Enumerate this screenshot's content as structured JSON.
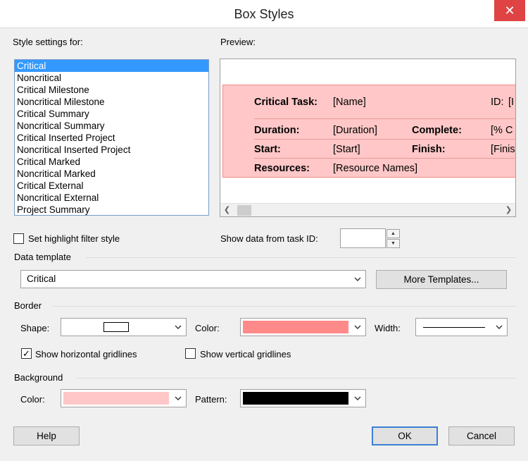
{
  "window": {
    "title": "Box Styles",
    "close_glyph": "✕"
  },
  "style_settings": {
    "label": "Style settings for:",
    "items": [
      "Critical",
      "Noncritical",
      "Critical Milestone",
      "Noncritical Milestone",
      "Critical Summary",
      "Noncritical Summary",
      "Critical Inserted Project",
      "Noncritical Inserted Project",
      "Critical Marked",
      "Noncritical Marked",
      "Critical External",
      "Noncritical External",
      "Project Summary"
    ],
    "selected": "Critical"
  },
  "preview": {
    "label": "Preview:",
    "rows": {
      "critical_task_label": "Critical Task:",
      "name_value": "[Name]",
      "id_label": "ID:",
      "id_value": "[I",
      "duration_label": "Duration:",
      "duration_value": "[Duration]",
      "complete_label": "Complete:",
      "complete_value": "[% C",
      "start_label": "Start:",
      "start_value": "[Start]",
      "finish_label": "Finish:",
      "finish_value": "[Finis",
      "resources_label": "Resources:",
      "resources_value": "[Resource Names]"
    },
    "box_fill_color": "#ffc7c7",
    "box_border_color": "#f08a8a"
  },
  "highlight_filter": {
    "label": "Set highlight filter style",
    "checked": false
  },
  "show_data": {
    "label": "Show data from task ID:",
    "value": ""
  },
  "data_template": {
    "header": "Data template",
    "selected": "Critical",
    "more_button": "More Templates..."
  },
  "border": {
    "header": "Border",
    "shape_label": "Shape:",
    "color_label": "Color:",
    "color_value": "#ff8a8a",
    "width_label": "Width:",
    "horizontal_gridlines": {
      "label": "Show horizontal gridlines",
      "checked": true,
      "check_glyph": "✓"
    },
    "vertical_gridlines": {
      "label": "Show vertical gridlines",
      "checked": false
    }
  },
  "background": {
    "header": "Background",
    "color_label": "Color:",
    "color_value": "#ffc7c7",
    "pattern_label": "Pattern:",
    "pattern_value": "#000000"
  },
  "buttons": {
    "help": "Help",
    "ok": "OK",
    "cancel": "Cancel"
  }
}
